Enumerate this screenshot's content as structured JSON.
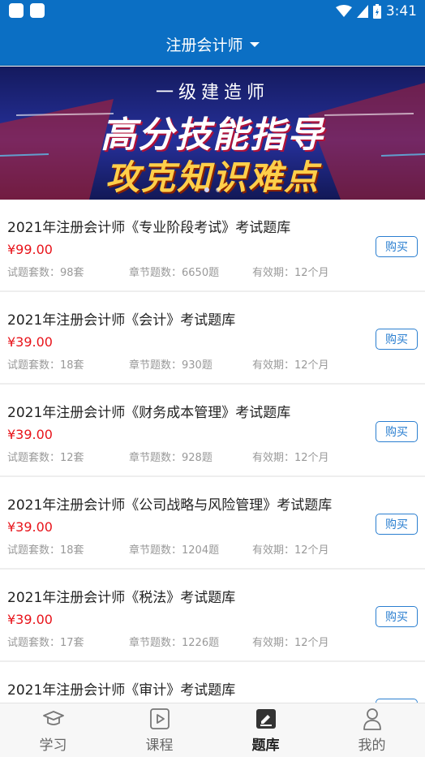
{
  "status_bar": {
    "time": "3:41"
  },
  "header": {
    "title": "注册会计师"
  },
  "banner": {
    "subtitle": "一级建造师",
    "line1": "高分技能指导",
    "line2": "攻克知识难点",
    "page_count": 2,
    "active_index": 0
  },
  "items": [
    {
      "title": "2021年注册会计师《专业阶段考试》考试题库",
      "price": "¥99.00",
      "sets": "试题套数：98套",
      "chapters": "章节题数：6650题",
      "validity": "有效期：12个月",
      "buy_label": "购买"
    },
    {
      "title": "2021年注册会计师《会计》考试题库",
      "price": "¥39.00",
      "sets": "试题套数：18套",
      "chapters": "章节题数：930题",
      "validity": "有效期：12个月",
      "buy_label": "购买"
    },
    {
      "title": "2021年注册会计师《财务成本管理》考试题库",
      "price": "¥39.00",
      "sets": "试题套数：12套",
      "chapters": "章节题数：928题",
      "validity": "有效期：12个月",
      "buy_label": "购买"
    },
    {
      "title": "2021年注册会计师《公司战略与风险管理》考试题库",
      "price": "¥39.00",
      "sets": "试题套数：18套",
      "chapters": "章节题数：1204题",
      "validity": "有效期：12个月",
      "buy_label": "购买"
    },
    {
      "title": "2021年注册会计师《税法》考试题库",
      "price": "¥39.00",
      "sets": "试题套数：17套",
      "chapters": "章节题数：1226题",
      "validity": "有效期：12个月",
      "buy_label": "购买"
    },
    {
      "title": "2021年注册会计师《审计》考试题库",
      "price": "",
      "sets": "",
      "chapters": "",
      "validity": "",
      "buy_label": ""
    }
  ],
  "tabs": [
    {
      "label": "学习",
      "icon": "graduation-cap-icon",
      "active": false
    },
    {
      "label": "课程",
      "icon": "play-video-icon",
      "active": false
    },
    {
      "label": "题库",
      "icon": "question-bank-icon",
      "active": true
    },
    {
      "label": "我的",
      "icon": "user-profile-icon",
      "active": false
    }
  ],
  "colors": {
    "primary": "#0b6fc4",
    "price": "#e8141b",
    "buy_border": "#2b7fd0"
  }
}
